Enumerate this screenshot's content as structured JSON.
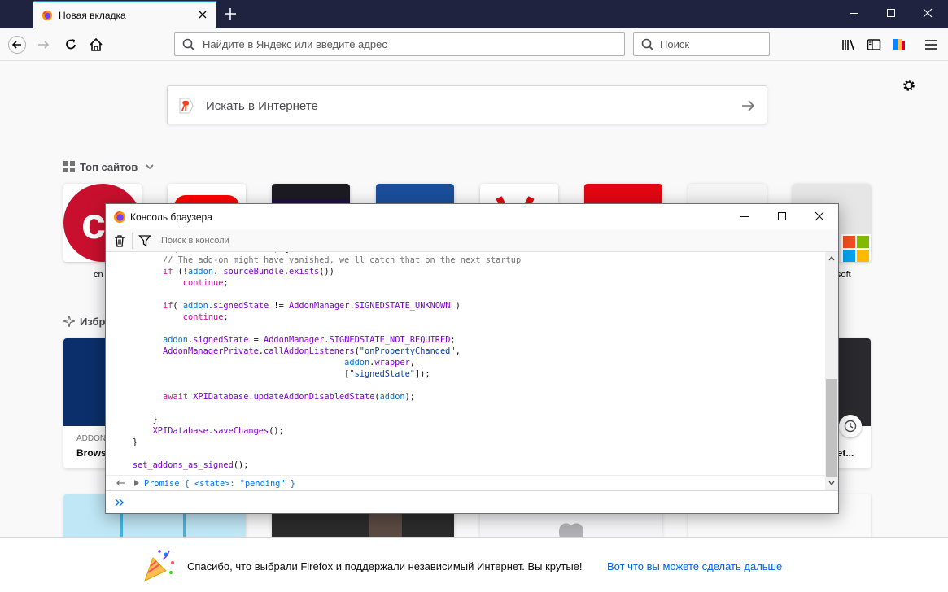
{
  "browser": {
    "tab_title": "Новая вкладка",
    "url_placeholder": "Найдите в Яндекс или введите адрес",
    "search_placeholder": "Поиск"
  },
  "newtab": {
    "yandex_search_placeholder": "Искать в Интернете",
    "top_sites_heading": "Топ сайтов",
    "highlights_heading": "Избр",
    "top_sites": [
      {
        "label": "cn"
      },
      {
        "label": ""
      },
      {
        "label": ""
      },
      {
        "label": ""
      },
      {
        "label": ""
      },
      {
        "label": ""
      },
      {
        "label": ""
      },
      {
        "label": "soft"
      }
    ],
    "cards": [
      {
        "source": "ADDON",
        "title": "Browse"
      },
      {
        "source": "",
        "title": "eet..."
      }
    ]
  },
  "footer": {
    "message": "Спасибо, что выбрали Firefox и поддержали независимый Интернет. Вы крутые!",
    "link": "Вот что вы можете сделать дальше"
  },
  "console": {
    "title": "Консоль браузера",
    "search_placeholder": "Поиск в консоли",
    "result": "Promise { <state>: \"pending\" }",
    "code_lines": [
      {
        "indent": "        ",
        "parts": [
          {
            "t": "for (let addon of addons) {",
            "c": "plain"
          }
        ]
      },
      {
        "indent": "          ",
        "parts": [
          {
            "t": "// The add-on might have vanished, we'll catch that on the next startup",
            "c": "com"
          }
        ]
      },
      {
        "indent": "          ",
        "parts": [
          {
            "t": "if",
            "c": "kw"
          },
          {
            "t": " (!",
            "c": "plain"
          },
          {
            "t": "addon",
            "c": "prop"
          },
          {
            "t": ".",
            "c": "plain"
          },
          {
            "t": "_sourceBundle",
            "c": "ident"
          },
          {
            "t": ".",
            "c": "plain"
          },
          {
            "t": "exists",
            "c": "ident"
          },
          {
            "t": "())",
            "c": "plain"
          }
        ]
      },
      {
        "indent": "              ",
        "parts": [
          {
            "t": "continue",
            "c": "kw"
          },
          {
            "t": ";",
            "c": "plain"
          }
        ]
      },
      {
        "indent": "",
        "parts": []
      },
      {
        "indent": "          ",
        "parts": [
          {
            "t": "if",
            "c": "kw"
          },
          {
            "t": "( ",
            "c": "plain"
          },
          {
            "t": "addon",
            "c": "prop"
          },
          {
            "t": ".",
            "c": "plain"
          },
          {
            "t": "signedState",
            "c": "ident"
          },
          {
            "t": " != ",
            "c": "plain"
          },
          {
            "t": "AddonManager",
            "c": "ident"
          },
          {
            "t": ".",
            "c": "plain"
          },
          {
            "t": "SIGNEDSTATE_UNKNOWN",
            "c": "ident"
          },
          {
            "t": " )",
            "c": "plain"
          }
        ]
      },
      {
        "indent": "              ",
        "parts": [
          {
            "t": "continue",
            "c": "kw"
          },
          {
            "t": ";",
            "c": "plain"
          }
        ]
      },
      {
        "indent": "",
        "parts": []
      },
      {
        "indent": "          ",
        "parts": [
          {
            "t": "addon",
            "c": "prop"
          },
          {
            "t": ".",
            "c": "plain"
          },
          {
            "t": "signedState",
            "c": "ident"
          },
          {
            "t": " = ",
            "c": "plain"
          },
          {
            "t": "AddonManager",
            "c": "ident"
          },
          {
            "t": ".",
            "c": "plain"
          },
          {
            "t": "SIGNEDSTATE_NOT_REQUIRED",
            "c": "ident"
          },
          {
            "t": ";",
            "c": "plain"
          }
        ]
      },
      {
        "indent": "          ",
        "parts": [
          {
            "t": "AddonManagerPrivate",
            "c": "ident"
          },
          {
            "t": ".",
            "c": "plain"
          },
          {
            "t": "callAddonListeners",
            "c": "ident"
          },
          {
            "t": "(",
            "c": "plain"
          },
          {
            "t": "\"onPropertyChanged\"",
            "c": "str"
          },
          {
            "t": ",",
            "c": "plain"
          }
        ]
      },
      {
        "indent": "                                              ",
        "parts": [
          {
            "t": "addon",
            "c": "prop"
          },
          {
            "t": ".",
            "c": "plain"
          },
          {
            "t": "wrapper",
            "c": "ident"
          },
          {
            "t": ",",
            "c": "plain"
          }
        ]
      },
      {
        "indent": "                                              ",
        "parts": [
          {
            "t": "[",
            "c": "plain"
          },
          {
            "t": "\"signedState\"",
            "c": "str"
          },
          {
            "t": "]);",
            "c": "plain"
          }
        ]
      },
      {
        "indent": "",
        "parts": []
      },
      {
        "indent": "          ",
        "parts": [
          {
            "t": "await",
            "c": "kw"
          },
          {
            "t": " ",
            "c": "plain"
          },
          {
            "t": "XPIDatabase",
            "c": "ident"
          },
          {
            "t": ".",
            "c": "plain"
          },
          {
            "t": "updateAddonDisabledState",
            "c": "ident"
          },
          {
            "t": "(",
            "c": "plain"
          },
          {
            "t": "addon",
            "c": "prop"
          },
          {
            "t": ");",
            "c": "plain"
          }
        ]
      },
      {
        "indent": "",
        "parts": []
      },
      {
        "indent": "        ",
        "parts": [
          {
            "t": "}",
            "c": "plain"
          }
        ]
      },
      {
        "indent": "        ",
        "parts": [
          {
            "t": "XPIDatabase",
            "c": "ident"
          },
          {
            "t": ".",
            "c": "plain"
          },
          {
            "t": "saveChanges",
            "c": "ident"
          },
          {
            "t": "();",
            "c": "plain"
          }
        ]
      },
      {
        "indent": "    ",
        "parts": [
          {
            "t": "}",
            "c": "plain"
          }
        ]
      },
      {
        "indent": "",
        "parts": []
      },
      {
        "indent": "    ",
        "parts": [
          {
            "t": "set_addons_as_signed",
            "c": "ident"
          },
          {
            "t": "();",
            "c": "plain"
          }
        ]
      }
    ]
  },
  "colors": {
    "tabbar": "#202340",
    "accent": "#0a84ff",
    "link": "#0060df",
    "yandex_red": "#fc3f1d"
  }
}
